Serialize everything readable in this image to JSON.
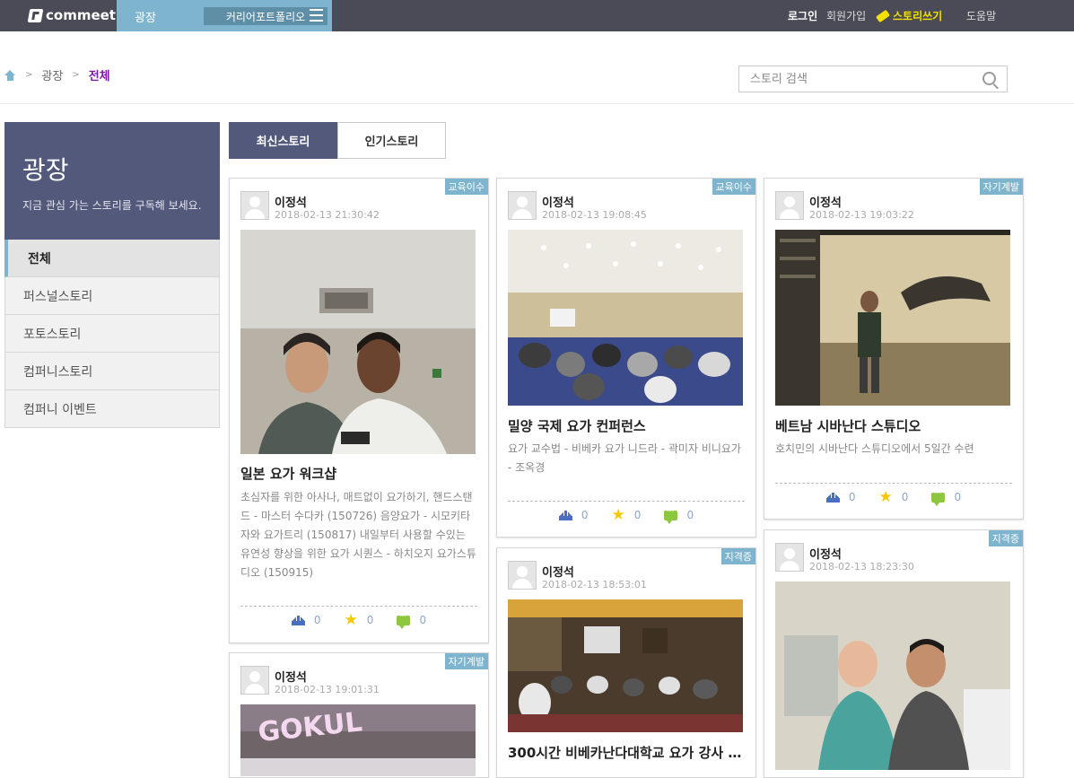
{
  "header": {
    "logo": "commeet",
    "plaza": "광장",
    "career_portfolio": "커리어포트폴리오",
    "login": "로그인",
    "signup": "회원가입",
    "write_story": "스토리쓰기",
    "help": "도움말"
  },
  "breadcrumb": {
    "level1": "광장",
    "current": "전체",
    "sep": ">"
  },
  "search": {
    "placeholder": "스토리 검색"
  },
  "sidebar": {
    "title": "광장",
    "subtitle": "지금 관심 가는 스토리를 구독해 보세요.",
    "items": [
      {
        "label": "전체"
      },
      {
        "label": "퍼스널스토리"
      },
      {
        "label": "포토스토리"
      },
      {
        "label": "컴퍼니스토리"
      },
      {
        "label": "컴퍼니 이벤트"
      }
    ]
  },
  "tabs": {
    "latest": "최신스토리",
    "popular": "인기스토리"
  },
  "cards": [
    {
      "badge": "교육이수",
      "author": "이정석",
      "date": "2018-02-13 21:30:42",
      "title": "일본 요가 워크샵",
      "desc": "초심자를 위한 아사나, 매트없이 요가하기, 핸드스탠드 - 마스터 수다카 (150726) 음양요가 - 시모키타자와 요가트리 (150817) 내일부터 사용할 수있는 유연성 향상을 위한 요가 시퀀스 - 하치오지 요가스튜디오 (150915)",
      "crowns": "0",
      "stars": "0",
      "comments": "0"
    },
    {
      "badge": "교육이수",
      "author": "이정석",
      "date": "2018-02-13 19:08:45",
      "title": "밀양 국제 요가 컨퍼런스",
      "desc": "요가 교수법 - 비베카 요가 니드라 - 곽미자 비니요가 - 조옥경",
      "crowns": "0",
      "stars": "0",
      "comments": "0"
    },
    {
      "badge": "자기계발",
      "author": "이정석",
      "date": "2018-02-13 19:03:22",
      "title": "베트남 시바난다 스튜디오",
      "desc": "호치민의 시바난다 스튜디오에서 5일간 수련",
      "crowns": "0",
      "stars": "0",
      "comments": "0"
    },
    {
      "badge": "자기계발",
      "author": "이정석",
      "date": "2018-02-13 19:01:31"
    },
    {
      "badge": "지격증",
      "author": "이정석",
      "date": "2018-02-13 18:53:01",
      "title": "300시간 비베카난다대학교 요가 강사 ..."
    },
    {
      "badge": "지격증",
      "author": "이정석",
      "date": "2018-02-13 18:23:30"
    }
  ],
  "colors": {
    "topbar": "#4a4b56",
    "accent": "#7fb4ce",
    "sidebar_head": "#52597a",
    "write": "#f5e000"
  }
}
